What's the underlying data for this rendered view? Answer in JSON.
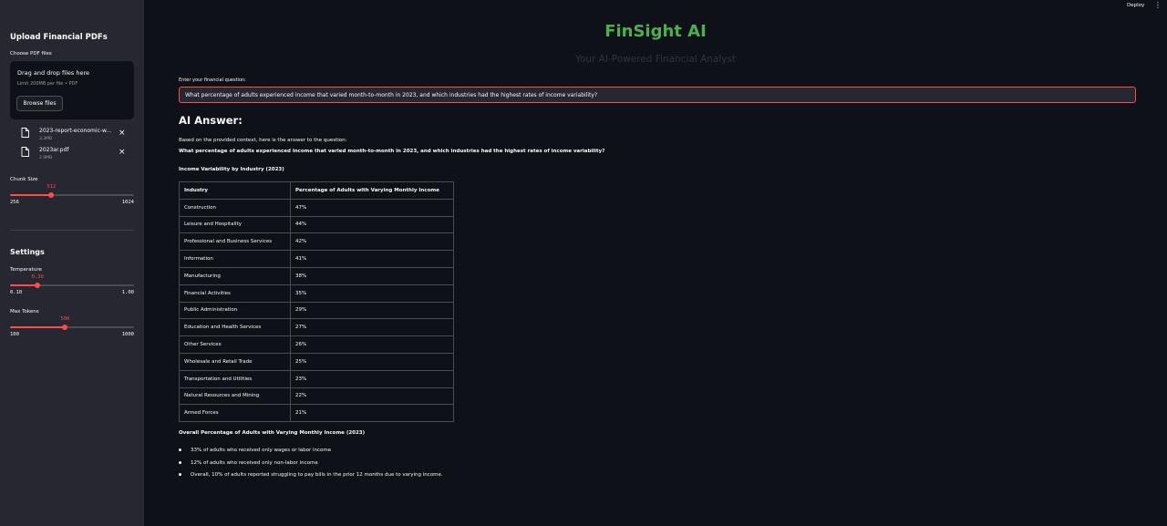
{
  "header": {
    "deploy_label": "Deploy",
    "menu_icon": "⋮"
  },
  "sidebar": {
    "title": "Upload Financial PDFs",
    "uploader_label": "Choose PDF files",
    "dropzone_title": "Drag and drop files here",
    "dropzone_sub": "Limit 200MB per file • PDF",
    "browse_label": "Browse files",
    "files": [
      {
        "name": "2023-report-economic-w...",
        "size": "3.3MB"
      },
      {
        "name": "2023ar.pdf",
        "size": "2.9MB"
      }
    ],
    "chunk": {
      "label": "Chunk Size",
      "value": "512",
      "min": "256",
      "max": "1024",
      "fraction": 0.333
    },
    "settings_title": "Settings",
    "temperature": {
      "label": "Temperature",
      "value": "0.30",
      "min": "0.10",
      "max": "1.00",
      "fraction": 0.222
    },
    "max_tokens": {
      "label": "Max Tokens",
      "value": "500",
      "min": "100",
      "max": "1000",
      "fraction": 0.444
    }
  },
  "main": {
    "title": "FinSight AI",
    "subtitle": "Your AI-Powered Financial Analyst",
    "question_label": "Enter your financial question:",
    "question_value": "What percentage of adults experienced income that varied month-to-month in 2023, and which industries had the highest rates of income variability?",
    "answer_heading": "AI Answer:",
    "answer_intro": "Based on the provided context, here is the answer to the question:",
    "answer_question": "What percentage of adults experienced income that varied month-to-month in 2023, and which industries had the highest rates of income variability?",
    "table_title": "Income Variability by Industry (2023)",
    "table_headers": [
      "Industry",
      "Percentage of Adults with Varying Monthly Income"
    ],
    "table_rows": [
      [
        "Construction",
        "47%"
      ],
      [
        "Leisure and Hospitality",
        "44%"
      ],
      [
        "Professional and Business Services",
        "42%"
      ],
      [
        "Information",
        "41%"
      ],
      [
        "Manufacturing",
        "38%"
      ],
      [
        "Financial Activities",
        "35%"
      ],
      [
        "Public Administration",
        "29%"
      ],
      [
        "Education and Health Services",
        "27%"
      ],
      [
        "Other Services",
        "26%"
      ],
      [
        "Wholesale and Retail Trade",
        "25%"
      ],
      [
        "Transportation and Utilities",
        "23%"
      ],
      [
        "Natural Resources and Mining",
        "22%"
      ],
      [
        "Armed Forces",
        "21%"
      ]
    ],
    "overall_title": "Overall Percentage of Adults with Varying Monthly Income (2023)",
    "bullets": [
      "33% of adults who received only wages or labor income",
      "12% of adults who received only non-labor income",
      "Overall, 10% of adults reported struggling to pay bills in the prior 12 months due to varying income."
    ]
  },
  "colors": {
    "accent": "#ff4b4b",
    "title_green": "#4caf50",
    "sidebar_bg": "#262730",
    "app_bg": "#0e1117"
  }
}
